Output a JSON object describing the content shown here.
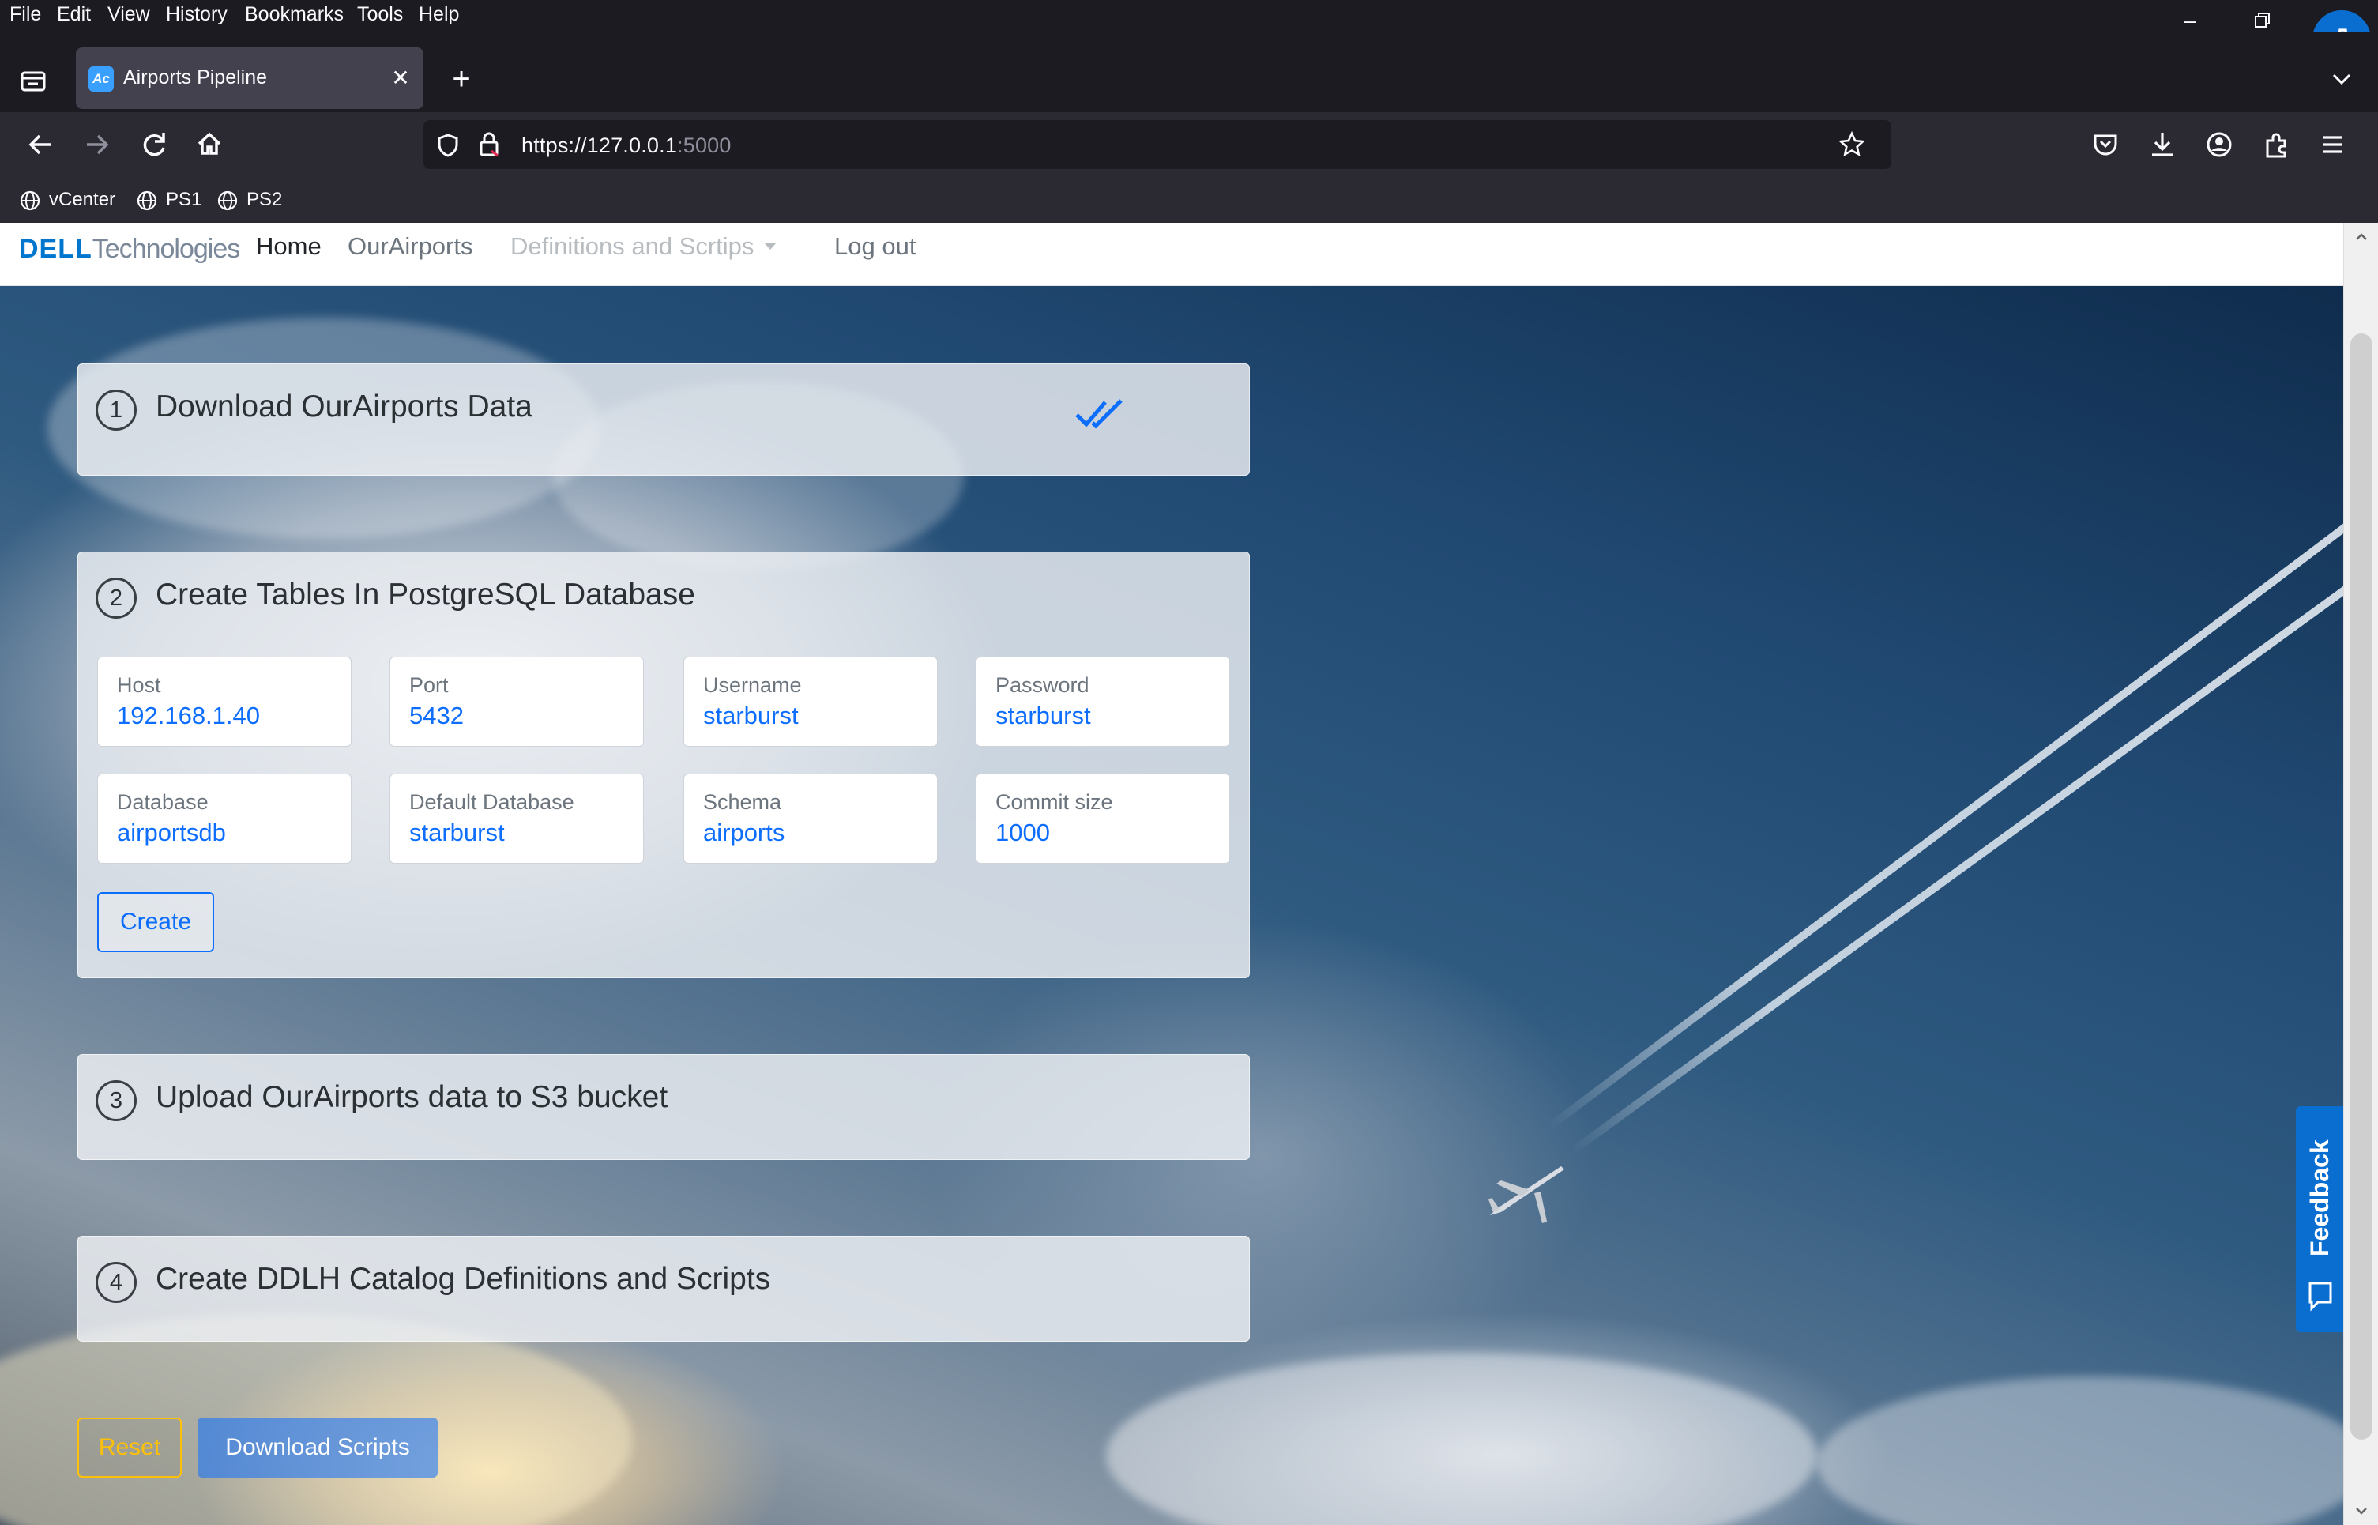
{
  "browser": {
    "menu": [
      "File",
      "Edit",
      "View",
      "History",
      "Bookmarks",
      "Tools",
      "Help"
    ],
    "tab": {
      "title": "Airports Pipeline",
      "favicon_text": "Ac"
    },
    "url": {
      "host": "https://127.0.0.1",
      "port": ":5000"
    },
    "bookmarks": [
      "vCenter",
      "PS1",
      "PS2"
    ],
    "icons": {
      "tab_list": "tab-list-icon",
      "back": "back-arrow-icon",
      "forward": "forward-arrow-icon",
      "reload": "reload-icon",
      "home": "home-icon",
      "shield": "shield-icon",
      "lock": "lock-icon",
      "star": "star-icon",
      "pocket": "pocket-icon",
      "download": "download-icon",
      "account": "account-icon",
      "extensions": "extensions-icon",
      "menu": "hamburger-menu-icon",
      "settings": "gear-icon"
    }
  },
  "site": {
    "brand": {
      "main": "DELL",
      "sub": "Technologies"
    },
    "nav": {
      "home": "Home",
      "ourairports": "OurAirports",
      "definitions": "Definitions and Scrtips",
      "logout": "Log out"
    }
  },
  "steps": [
    {
      "number": "1",
      "title": "Download OurAirports Data",
      "completed": true
    },
    {
      "number": "2",
      "title": "Create Tables In PostgreSQL Database",
      "fields": [
        {
          "label": "Host",
          "value": "192.168.1.40"
        },
        {
          "label": "Port",
          "value": "5432"
        },
        {
          "label": "Username",
          "value": "starburst"
        },
        {
          "label": "Password",
          "value": "starburst"
        },
        {
          "label": "Database",
          "value": "airportsdb"
        },
        {
          "label": "Default Database",
          "value": "starburst"
        },
        {
          "label": "Schema",
          "value": "airports"
        },
        {
          "label": "Commit size",
          "value": "1000"
        }
      ],
      "button": "Create"
    },
    {
      "number": "3",
      "title": "Upload OurAirports data to S3 bucket"
    },
    {
      "number": "4",
      "title": "Create DDLH Catalog Definitions and Scripts"
    }
  ],
  "actions": {
    "reset": "Reset",
    "download": "Download Scripts"
  },
  "feedback": {
    "label": "Feedback"
  },
  "colors": {
    "primary": "#0d6efd",
    "warning": "#ffc107",
    "feedback": "#0a6ed1"
  }
}
